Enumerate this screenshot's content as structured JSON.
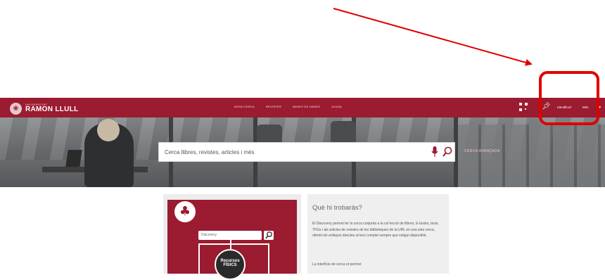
{
  "header": {
    "logo_small": "UNIVERSITAT",
    "logo_big": "RAMON LLULL",
    "nav_links": [
      "NOVA CERCA",
      "REVISTES",
      "BASES DE DADES",
      "AJUDA"
    ],
    "login_label": "Identifica't",
    "more_label": "Més",
    "qr_icon": "qr-code-icon",
    "pin_icon": "pin-icon"
  },
  "search": {
    "placeholder": "Cerca llibres, revistes, articles i més",
    "advanced_label": "CERCA AVANÇADA"
  },
  "left_card": {
    "mini_search_placeholder": "Discovery",
    "resource_line1": "Recursos",
    "resource_line2": "FÍSICS"
  },
  "right_card": {
    "title": "Què hi trobaràs?",
    "body": "El Discovery permet fer la cerca conjunta a la col·lecció de llibres, E-books, tesis, TFGs i als articles de revistes de les biblioteques de la URL en una sola cerca, oferint els enllaços directes al text complet sempre que estigui disponible.",
    "subtitle": "La interfície de cerca et permet:"
  },
  "colors": {
    "brand": "#9b1b30",
    "annotation": "#e00000"
  }
}
